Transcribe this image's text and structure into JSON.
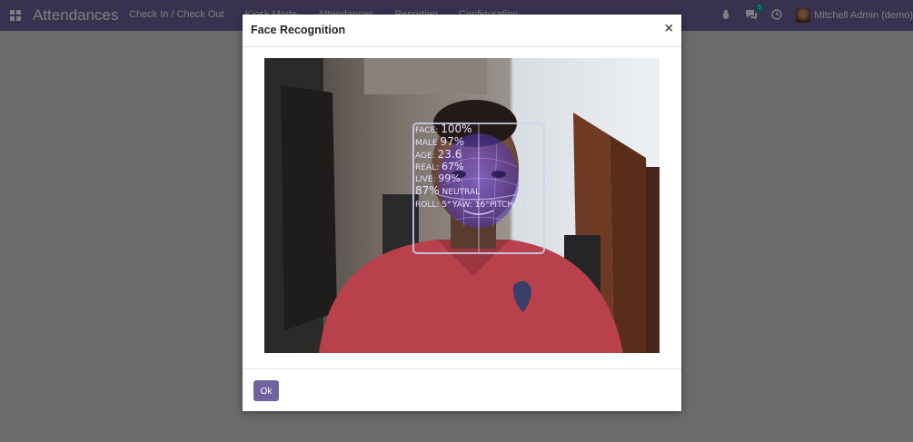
{
  "navbar": {
    "brand": "Attendances",
    "menu": [
      "Check In / Check Out",
      "Kiosk Mode",
      "Attendances",
      "Reporting",
      "Configuration"
    ],
    "messages_count": "5",
    "user_name": "Mitchell Admin (demo)"
  },
  "dialog": {
    "title": "Face Recognition",
    "close_label": "×",
    "ok_label": "Ok"
  },
  "face_overlay": {
    "face_label": "FACE:",
    "face_value": "100%",
    "gender_label": "MALE",
    "gender_value": "97%",
    "age_label": "AGE:",
    "age_value": "23.6",
    "real_label": "REAL:",
    "real_value": "67%",
    "live_label": "LIVE:",
    "live_value": "99%",
    "emotion_value": "87%",
    "emotion_label": "NEUTRAL",
    "roll_label": "ROLL: 5°",
    "yaw_label": "YAW: 16°",
    "pitch_label": "PITCH: 14°"
  }
}
